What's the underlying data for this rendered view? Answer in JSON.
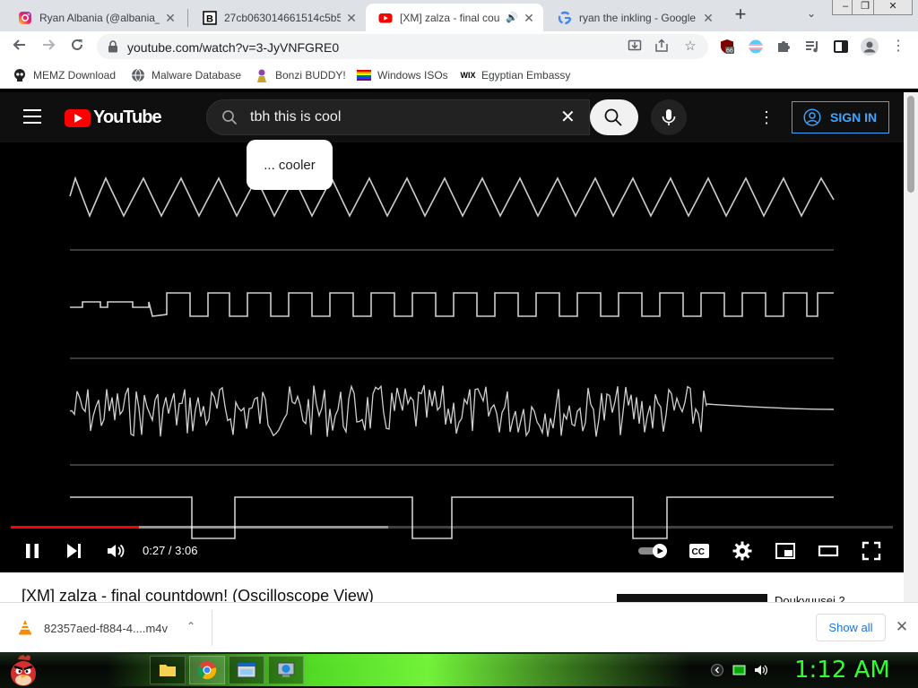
{
  "browser": {
    "tabs": [
      {
        "title": "Ryan Albania (@albania_",
        "icon": "instagram-icon",
        "active": false
      },
      {
        "title": "27cb063014661514c5b5",
        "icon": "b-square-icon",
        "active": false
      },
      {
        "title": "[XM] zalza - final cou",
        "icon": "youtube-icon",
        "active": true,
        "audio": "🔊"
      },
      {
        "title": "ryan the inkling - Google",
        "icon": "google-icon",
        "active": false
      }
    ],
    "new_tab_label": "+",
    "tab_list_label": "⌄",
    "window_controls": {
      "minimize": "‒",
      "restore": "❐",
      "close": "✕"
    },
    "url": "youtube.com/watch?v=3-JyVNFGRE0",
    "extension_badge": "66",
    "bookmarks": [
      {
        "label": "MEMZ Download",
        "icon": "skull-icon"
      },
      {
        "label": "Malware Database",
        "icon": "globe-icon"
      },
      {
        "label": "Bonzi BUDDY!",
        "icon": "bonzi-icon"
      },
      {
        "label": "Windows ISOs",
        "icon": "rainbow-flag-icon"
      },
      {
        "label": "Egyptian Embassy",
        "icon": "wix-icon"
      }
    ]
  },
  "youtube": {
    "logo_text": "YouTube",
    "search_value": "tbh this is cool",
    "search_suggestion": "... cooler",
    "clear_label": "✕",
    "menu_dots": "⋮",
    "sign_in_label": "SIGN IN",
    "player": {
      "current_time": "0:27",
      "duration": "3:06",
      "time_text": "0:27 / 3:06",
      "progress_fraction": 0.145,
      "buffered_fraction": 0.428,
      "cc_label": "CC"
    },
    "video_title": "[XM] zalza - final countdown! (Oscilloscope View)",
    "related_title": "Doukyuusei 2"
  },
  "downloads": {
    "file_name": "82357aed-f884-4....m4v",
    "show_all_label": "Show all",
    "close_label": "✕",
    "caret_label": "⌃"
  },
  "taskbar": {
    "clock": "1:12 AM",
    "colors": {
      "accent": "#2fff2f"
    }
  },
  "colors": {
    "youtube_red": "#ff0000",
    "youtube_bg": "#0f0f0f",
    "signin_blue": "#3ea6ff",
    "link_blue": "#1a73e8"
  }
}
